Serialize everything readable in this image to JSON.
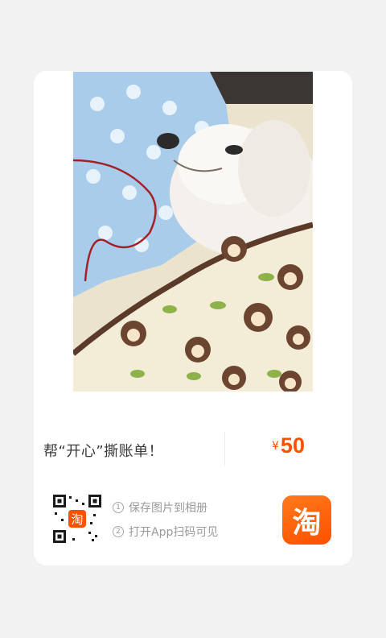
{
  "card": {
    "title": "帮“开心”撕账单！",
    "price_currency": "¥",
    "price_value": "50",
    "steps": [
      {
        "num": "1",
        "text": "保存图片到相册"
      },
      {
        "num": "2",
        "text": "打开App扫码可见"
      }
    ],
    "app_logo_glyph": "淘"
  },
  "colors": {
    "accent": "#ff5000",
    "card_bg": "#ffffff",
    "page_bg": "#f2f2f2"
  }
}
